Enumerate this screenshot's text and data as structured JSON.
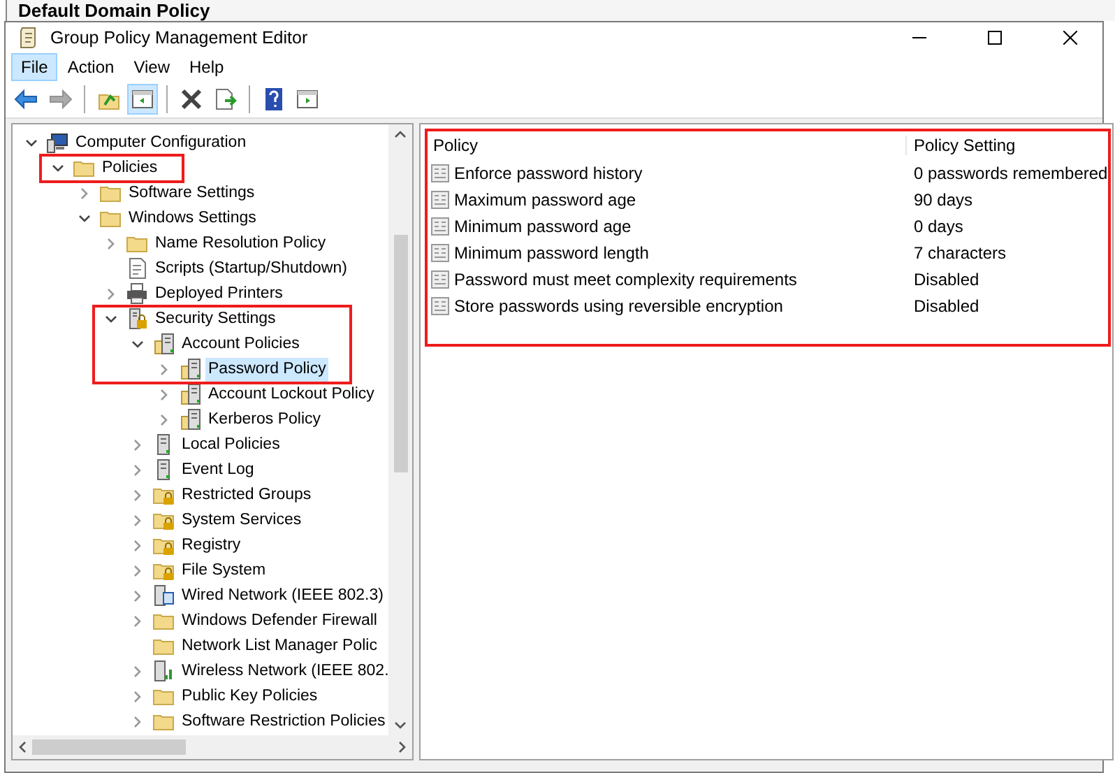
{
  "background_window": {
    "title": "Default Domain Policy"
  },
  "window": {
    "title": "Group Policy Management Editor"
  },
  "menu": [
    {
      "label": "File",
      "selected": true
    },
    {
      "label": "Action",
      "selected": false
    },
    {
      "label": "View",
      "selected": false
    },
    {
      "label": "Help",
      "selected": false
    }
  ],
  "toolbar": [
    {
      "kind": "back",
      "pressed": false,
      "disabled": false
    },
    {
      "kind": "forward",
      "pressed": false,
      "disabled": true
    },
    {
      "kind": "separator"
    },
    {
      "kind": "up",
      "pressed": false,
      "disabled": false
    },
    {
      "kind": "tree",
      "pressed": true,
      "disabled": false
    },
    {
      "kind": "separator"
    },
    {
      "kind": "delete",
      "pressed": false,
      "disabled": false
    },
    {
      "kind": "export",
      "pressed": false,
      "disabled": false
    },
    {
      "kind": "separator"
    },
    {
      "kind": "help",
      "pressed": false,
      "disabled": false
    },
    {
      "kind": "pane",
      "pressed": false,
      "disabled": false
    }
  ],
  "tree": [
    {
      "label": "Computer Configuration",
      "kind": "computer",
      "has_children": true,
      "expanded": true,
      "selected": false,
      "highlighted": false,
      "children": [
        {
          "label": "Policies",
          "kind": "folder",
          "has_children": true,
          "expanded": true,
          "selected": false,
          "highlighted": true,
          "children": [
            {
              "label": "Software Settings",
              "kind": "folder",
              "has_children": true,
              "expanded": false,
              "selected": false,
              "highlighted": false
            },
            {
              "label": "Windows Settings",
              "kind": "folder",
              "has_children": true,
              "expanded": true,
              "selected": false,
              "highlighted": false,
              "children": [
                {
                  "label": "Name Resolution Policy",
                  "kind": "folder",
                  "has_children": true,
                  "expanded": false,
                  "selected": false,
                  "highlighted": false
                },
                {
                  "label": "Scripts (Startup/Shutdown)",
                  "kind": "script",
                  "has_children": false,
                  "expanded": false,
                  "selected": false,
                  "highlighted": false
                },
                {
                  "label": "Deployed Printers",
                  "kind": "printer",
                  "has_children": true,
                  "expanded": false,
                  "selected": false,
                  "highlighted": false
                },
                {
                  "label": "Security Settings",
                  "kind": "security",
                  "has_children": true,
                  "expanded": true,
                  "selected": false,
                  "highlighted": true,
                  "children": [
                    {
                      "label": "Account Policies",
                      "kind": "policy",
                      "has_children": true,
                      "expanded": true,
                      "selected": false,
                      "highlighted": true,
                      "children": [
                        {
                          "label": "Password Policy",
                          "kind": "policy",
                          "has_children": true,
                          "expanded": false,
                          "selected": true,
                          "highlighted": true
                        },
                        {
                          "label": "Account Lockout Policy",
                          "kind": "policy",
                          "has_children": true,
                          "expanded": false,
                          "selected": false,
                          "highlighted": false
                        },
                        {
                          "label": "Kerberos Policy",
                          "kind": "policy",
                          "has_children": true,
                          "expanded": false,
                          "selected": false,
                          "highlighted": false
                        }
                      ]
                    },
                    {
                      "label": "Local Policies",
                      "kind": "server",
                      "has_children": true,
                      "expanded": false,
                      "selected": false,
                      "highlighted": false
                    },
                    {
                      "label": "Event Log",
                      "kind": "server",
                      "has_children": true,
                      "expanded": false,
                      "selected": false,
                      "highlighted": false
                    },
                    {
                      "label": "Restricted Groups",
                      "kind": "lockfolder",
                      "has_children": true,
                      "expanded": false,
                      "selected": false,
                      "highlighted": false
                    },
                    {
                      "label": "System Services",
                      "kind": "lockfolder",
                      "has_children": true,
                      "expanded": false,
                      "selected": false,
                      "highlighted": false
                    },
                    {
                      "label": "Registry",
                      "kind": "lockfolder",
                      "has_children": true,
                      "expanded": false,
                      "selected": false,
                      "highlighted": false
                    },
                    {
                      "label": "File System",
                      "kind": "lockfolder",
                      "has_children": true,
                      "expanded": false,
                      "selected": false,
                      "highlighted": false
                    },
                    {
                      "label": "Wired Network (IEEE 802.3)",
                      "kind": "network",
                      "has_children": true,
                      "expanded": false,
                      "selected": false,
                      "highlighted": false
                    },
                    {
                      "label": "Windows Defender Firewall",
                      "kind": "folder",
                      "has_children": true,
                      "expanded": false,
                      "selected": false,
                      "highlighted": false
                    },
                    {
                      "label": "Network List Manager Polic",
                      "kind": "folder",
                      "has_children": false,
                      "expanded": false,
                      "selected": false,
                      "highlighted": false
                    },
                    {
                      "label": "Wireless Network (IEEE 802.",
                      "kind": "wireless",
                      "has_children": true,
                      "expanded": false,
                      "selected": false,
                      "highlighted": false
                    },
                    {
                      "label": "Public Key Policies",
                      "kind": "folder",
                      "has_children": true,
                      "expanded": false,
                      "selected": false,
                      "highlighted": false
                    },
                    {
                      "label": "Software Restriction Policies",
                      "kind": "folder",
                      "has_children": true,
                      "expanded": false,
                      "selected": false,
                      "highlighted": false
                    }
                  ]
                }
              ]
            }
          ]
        }
      ]
    }
  ],
  "list": {
    "highlighted": true,
    "columns": [
      "Policy",
      "Policy Setting"
    ],
    "rows": [
      [
        "Enforce password history",
        "0 passwords remembered"
      ],
      [
        "Maximum password age",
        "90 days"
      ],
      [
        "Minimum password age",
        "0 days"
      ],
      [
        "Minimum password length",
        "7 characters"
      ],
      [
        "Password must meet complexity requirements",
        "Disabled"
      ],
      [
        "Store passwords using reversible encryption",
        "Disabled"
      ]
    ]
  }
}
